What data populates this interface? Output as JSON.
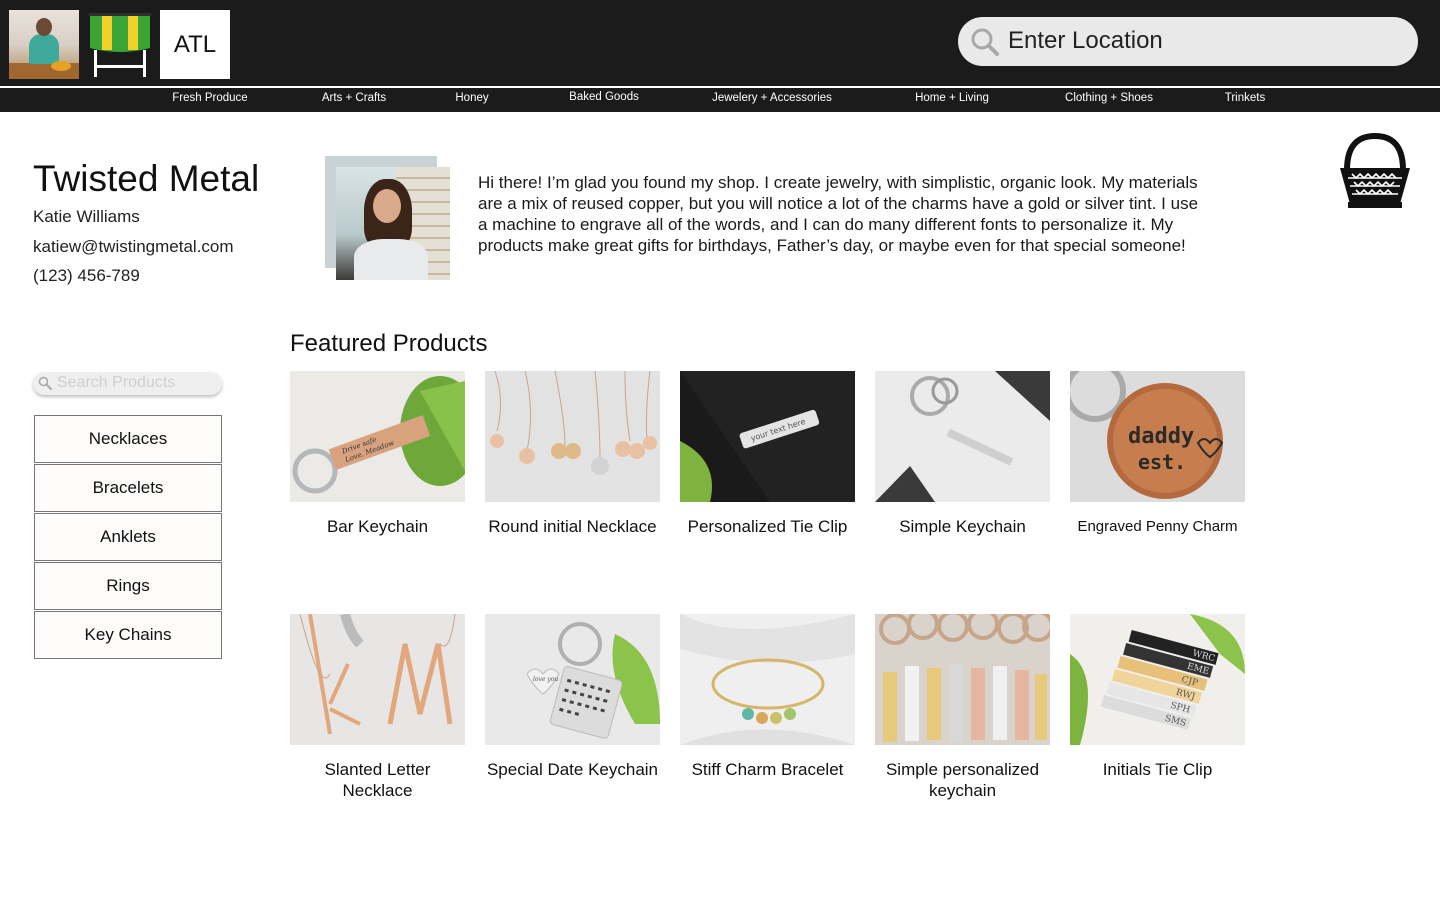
{
  "header": {
    "city_label": "ATL",
    "location_search": {
      "placeholder": "Enter Location"
    }
  },
  "nav": {
    "items": [
      "Fresh Produce",
      "Arts + Crafts",
      "Honey",
      "Baked Goods",
      "Jewelery + Accessories",
      "Home + Living",
      "Clothing + Shoes",
      "Trinkets"
    ]
  },
  "shop": {
    "name": "Twisted Metal",
    "owner": "Katie Williams",
    "email": "katiew@twistingmetal.com",
    "phone": "(123) 456-789",
    "bio": "Hi there!  I’m glad you found my shop.  I create jewelry, with simplistic, organic look.  My materials are a mix of reused copper, but you will notice a lot of the charms have a gold or silver tint.  I use a machine to engrave all of the words, and I can do many different fonts to personalize it.  My products make great gifts for birthdays, Father’s day, or maybe even for that special someone!"
  },
  "sidebar": {
    "search_placeholder": "Search Products",
    "categories": [
      "Necklaces",
      "Bracelets",
      "Anklets",
      "Rings",
      "Key Chains"
    ]
  },
  "featured": {
    "title": "Featured Products",
    "products": [
      {
        "name": "Bar Keychain",
        "thumb_text": [
          "Drive safe",
          "Love, Meadow"
        ]
      },
      {
        "name": "Round initial Necklace"
      },
      {
        "name": "Personalized Tie Clip",
        "thumb_text": [
          "your text here"
        ]
      },
      {
        "name": "Simple Keychain"
      },
      {
        "name": "Engraved Penny Charm",
        "thumb_text": [
          "daddy",
          "est."
        ]
      },
      {
        "name": "Slanted Letter Necklace"
      },
      {
        "name": "Special Date Keychain",
        "thumb_text": [
          "love you"
        ]
      },
      {
        "name": "Stiff Charm Bracelet"
      },
      {
        "name": "Simple personalized keychain"
      },
      {
        "name": "Initials Tie Clip",
        "thumb_text": [
          "WRC",
          "EME",
          "CJP",
          "RWJ",
          "SPH",
          "SMS"
        ]
      }
    ]
  },
  "colors": {
    "header_bg": "#1b1b1b",
    "nav_text": "#ffffff",
    "search_bg": "#e9e9e9",
    "category_border": "#777777"
  }
}
